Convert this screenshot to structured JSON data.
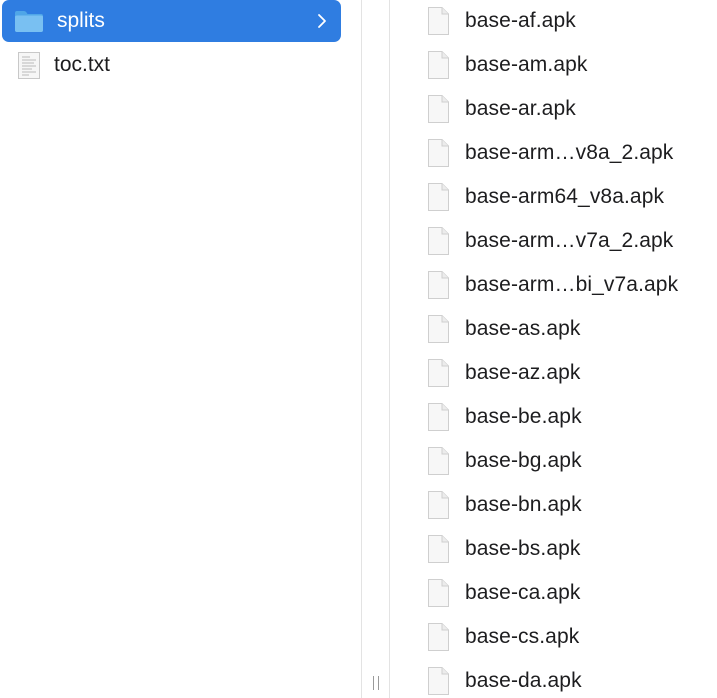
{
  "left_column": {
    "items": [
      {
        "label": "splits",
        "icon": "folder-icon",
        "selected": true,
        "has_children": true
      },
      {
        "label": "toc.txt",
        "icon": "text-file-icon",
        "selected": false,
        "has_children": false
      }
    ]
  },
  "right_column": {
    "files": [
      "base-af.apk",
      "base-am.apk",
      "base-ar.apk",
      "base-arm…v8a_2.apk",
      "base-arm64_v8a.apk",
      "base-arm…v7a_2.apk",
      "base-arm…bi_v7a.apk",
      "base-as.apk",
      "base-az.apk",
      "base-be.apk",
      "base-bg.apk",
      "base-bn.apk",
      "base-bs.apk",
      "base-ca.apk",
      "base-cs.apk",
      "base-da.apk"
    ]
  },
  "colors": {
    "selection": "#2f7de1",
    "folder": "#63b2ee",
    "text": "#1d1d1f"
  }
}
